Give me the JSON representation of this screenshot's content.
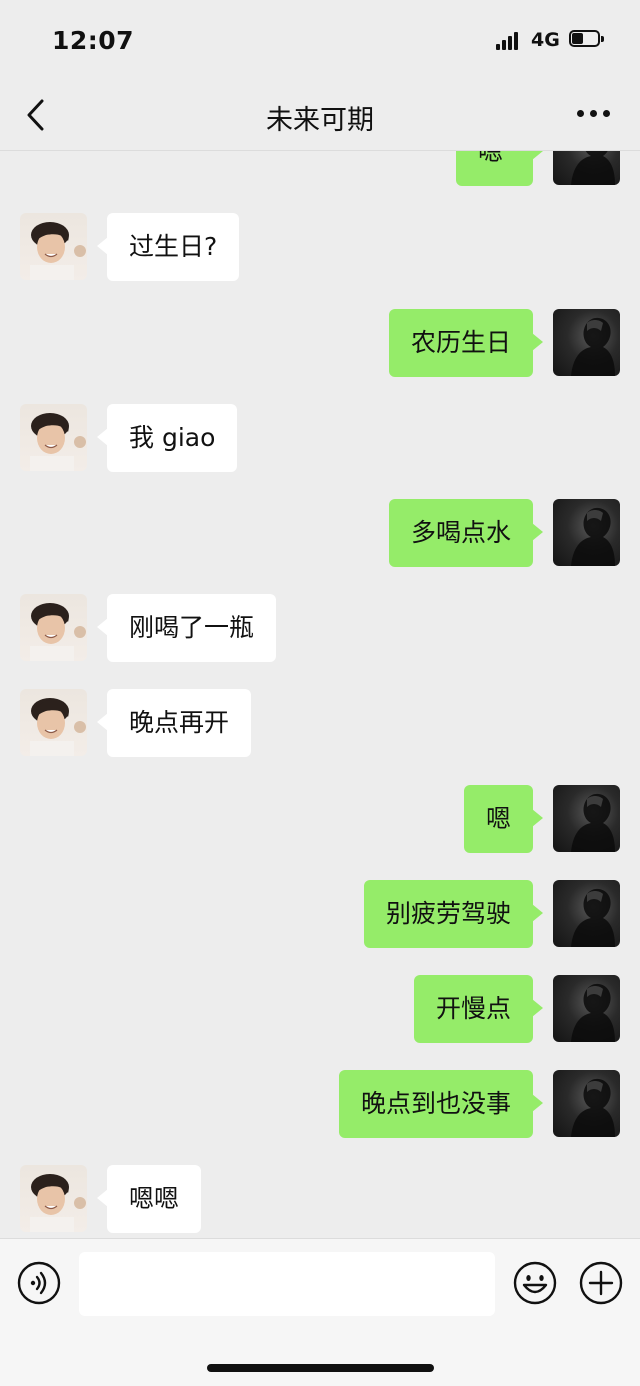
{
  "status_bar": {
    "time": "12:07",
    "network": "4G",
    "battery_percent": 45
  },
  "header": {
    "title": "未来可期"
  },
  "icons": {
    "back": "chevron-left-icon",
    "more": "more-dots-icon",
    "voice": "voice-icon",
    "emoji": "emoji-icon",
    "plus": "plus-icon"
  },
  "colors": {
    "sent_bubble": "#95ec69",
    "received_bubble": "#ffffff",
    "background": "#ededed"
  },
  "messages": [
    {
      "side": "right",
      "text": "嗯"
    },
    {
      "side": "left",
      "text": "过生日?"
    },
    {
      "side": "right",
      "text": "农历生日"
    },
    {
      "side": "left",
      "text": "我 giao"
    },
    {
      "side": "right",
      "text": "多喝点水"
    },
    {
      "side": "left",
      "text": "刚喝了一瓶"
    },
    {
      "side": "left",
      "text": "晚点再开"
    },
    {
      "side": "right",
      "text": "嗯"
    },
    {
      "side": "right",
      "text": "别疲劳驾驶"
    },
    {
      "side": "right",
      "text": "开慢点"
    },
    {
      "side": "right",
      "text": "晚点到也没事"
    },
    {
      "side": "left",
      "text": "嗯嗯"
    }
  ],
  "composer": {
    "value": "",
    "placeholder": ""
  }
}
